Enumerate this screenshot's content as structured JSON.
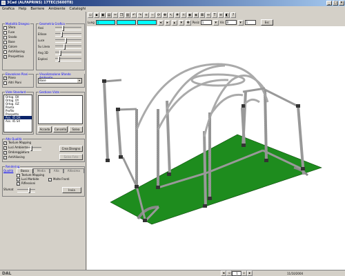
{
  "window": {
    "title": "3Cad (ALFAPRINS) 17TEC(5600T8)",
    "controls": [
      "_",
      "□",
      "×"
    ]
  },
  "menu": [
    "Grafica",
    "Help",
    "Barriere",
    "Ambiente",
    "Cataloghi"
  ],
  "toolbar": {
    "fields": {
      "lung_label": "Lung",
      "lung_value": "1",
      "pos_label": "Posiz",
      "pos_value": "1",
      "vis_label": "Vis",
      "vis_value": "0",
      "dist_value": "1"
    },
    "esc_label": "Esc"
  },
  "left": {
    "modalita": {
      "title": "Modalità Disegno",
      "items": [
        {
          "label": "Sfera",
          "checked": false
        },
        {
          "label": "Fuse",
          "checked": false
        },
        {
          "label": "Snodo",
          "checked": false
        },
        {
          "label": "Base",
          "checked": false
        },
        {
          "label": "Colore",
          "checked": true
        },
        {
          "label": "AntiAliasing",
          "checked": false
        },
        {
          "label": "Prospettiva",
          "checked": true
        }
      ]
    },
    "geometria": {
      "title": "Geometria Grafica",
      "items": [
        {
          "label": "Assi"
        },
        {
          "label": "Ellisse"
        },
        {
          "label": "Luce"
        },
        {
          "label": "Su Linea"
        },
        {
          "label": "Ang 3D"
        },
        {
          "label": "Esplosi"
        }
      ]
    },
    "elevazione": {
      "title": "Elevazione Piani",
      "items": [
        {
          "label": "Piano",
          "checked": true
        },
        {
          "label": "Altri Piani",
          "checked": false
        }
      ]
    },
    "visualizzazione": {
      "title": "Visualizzazione Sfondo Ambiente",
      "select_value": "Base"
    },
    "viste": {
      "title": "Viste Standard",
      "items": [
        "Ortog. OX",
        "Ortog. OY",
        "Ortog. OZ",
        "Pianta",
        "Profilo",
        "Prospetto",
        "Ass. 45 DX",
        "Ass. 45 SX"
      ],
      "selected_index": 6
    },
    "gestione": {
      "title": "Gestione Viste",
      "buttons": [
        "Accoda",
        "Cancella",
        "Salva"
      ]
    },
    "alto": {
      "title": "Alto Qualità",
      "items": [
        {
          "label": "Texture Mapping",
          "checked": true
        },
        {
          "label": "Luci Ambiente",
          "checked": true
        },
        {
          "label": "Ombreggiatura",
          "checked": true
        },
        {
          "label": "AntiAliasing",
          "checked": true
        }
      ],
      "btn1": "Crea Disegno",
      "btn2": "Salva Foto"
    },
    "rendering": {
      "title": "Rendering",
      "qualita_label": "Qualità",
      "tabs": [
        "Bassa",
        "Media",
        "Alta",
        "Altissima"
      ],
      "active_tab": 0,
      "items": [
        {
          "label": "Texture Mapping",
          "checked": false
        },
        {
          "label": "Luci Morbide",
          "checked": true
        },
        {
          "label": "Riflessioni",
          "checked": true
        }
      ],
      "extra_label": "Molte Fronti",
      "extra_checked": true,
      "sfumat_label": "Sfumat",
      "invia": "Invia"
    }
  },
  "status": {
    "logo": "DAL",
    "page": "1",
    "date": "11/10/2004"
  },
  "colors": {
    "floor": "#1e8c1e",
    "truss": "#8a8a8a",
    "accent": "#00ffff"
  }
}
